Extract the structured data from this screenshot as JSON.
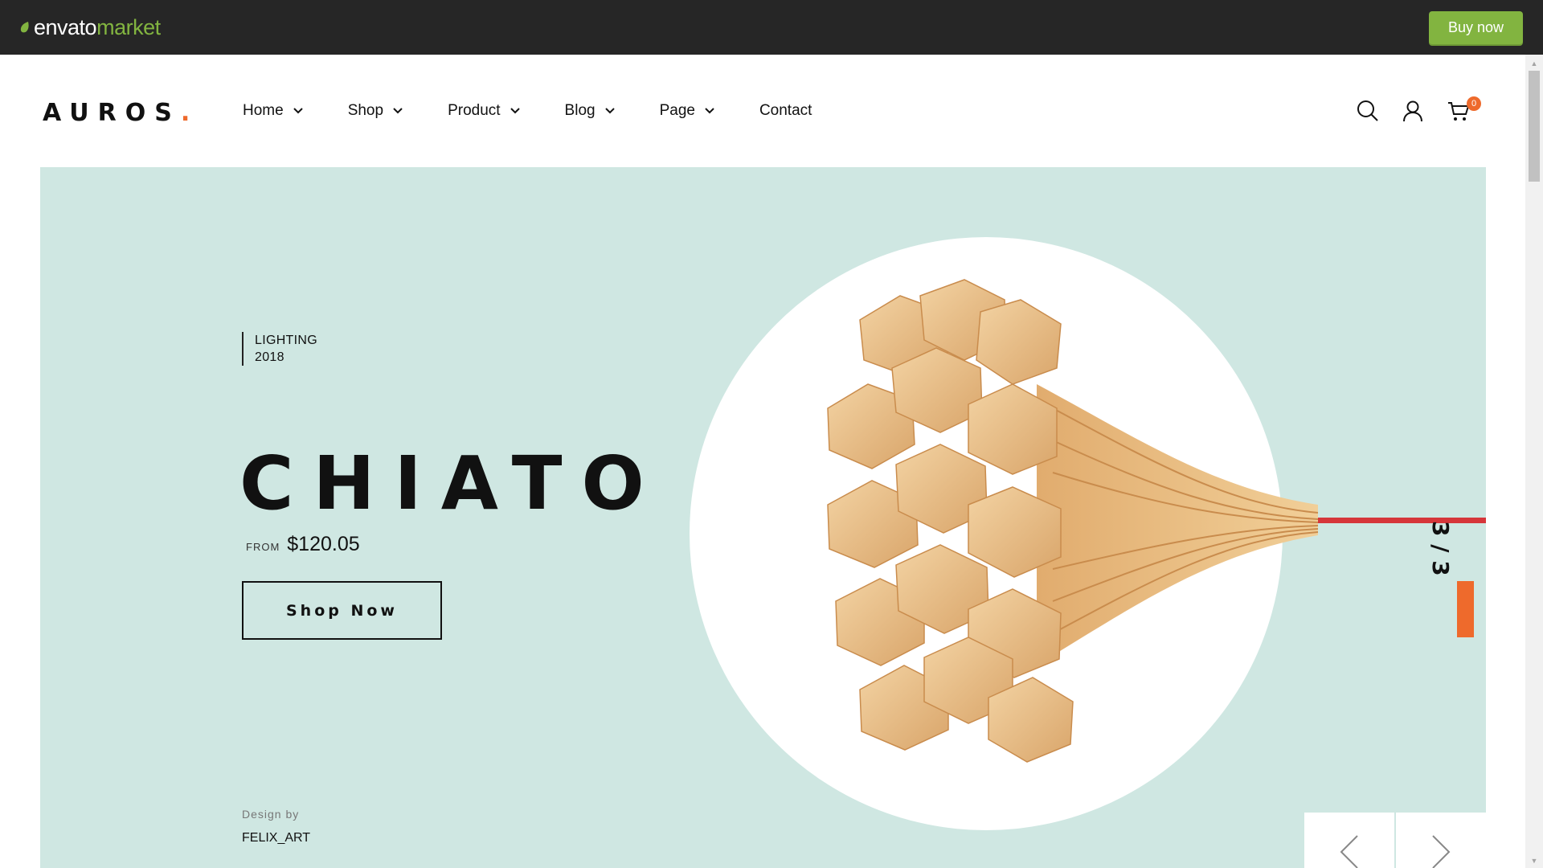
{
  "envato": {
    "word": "envato",
    "market": "market",
    "buy_label": "Buy now"
  },
  "header": {
    "brand": "AUROS",
    "brand_dot": ".",
    "nav": [
      {
        "label": "Home"
      },
      {
        "label": "Shop"
      },
      {
        "label": "Product"
      },
      {
        "label": "Blog"
      },
      {
        "label": "Page"
      },
      {
        "label": "Contact"
      }
    ],
    "cart_count": "0"
  },
  "hero": {
    "category": "LIGHTING",
    "year": "2018",
    "title": "CHIATO",
    "from_label": "FROM",
    "price": "$120.05",
    "cta_label": "Shop Now",
    "design_by_label": "Design by",
    "designer": "FELIX_ART",
    "slide_counter": "3 / 3"
  },
  "colors": {
    "accent": "#ee6a2c",
    "envato_green": "#82b440",
    "hero_bg": "#cfe7e2",
    "envato_bar": "#262626"
  },
  "icons": [
    "leaf-icon",
    "chevron-down-icon",
    "search-icon",
    "user-icon",
    "cart-icon",
    "arrow-left-icon",
    "arrow-right-icon",
    "lamp-image"
  ]
}
